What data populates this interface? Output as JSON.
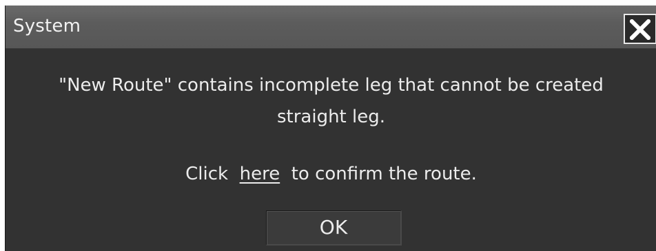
{
  "dialog": {
    "title": "System",
    "close_icon": "close-x-icon",
    "message_line1": "\"New Route\" contains incomplete leg that cannot be created",
    "message_line2": "straight leg.",
    "confirm_prefix": "Click",
    "confirm_link": "here",
    "confirm_suffix": "to confirm the route.",
    "ok_label": "OK"
  },
  "colors": {
    "background": "#323232",
    "titlebar": "#5c5c5c",
    "text": "#ececec"
  }
}
